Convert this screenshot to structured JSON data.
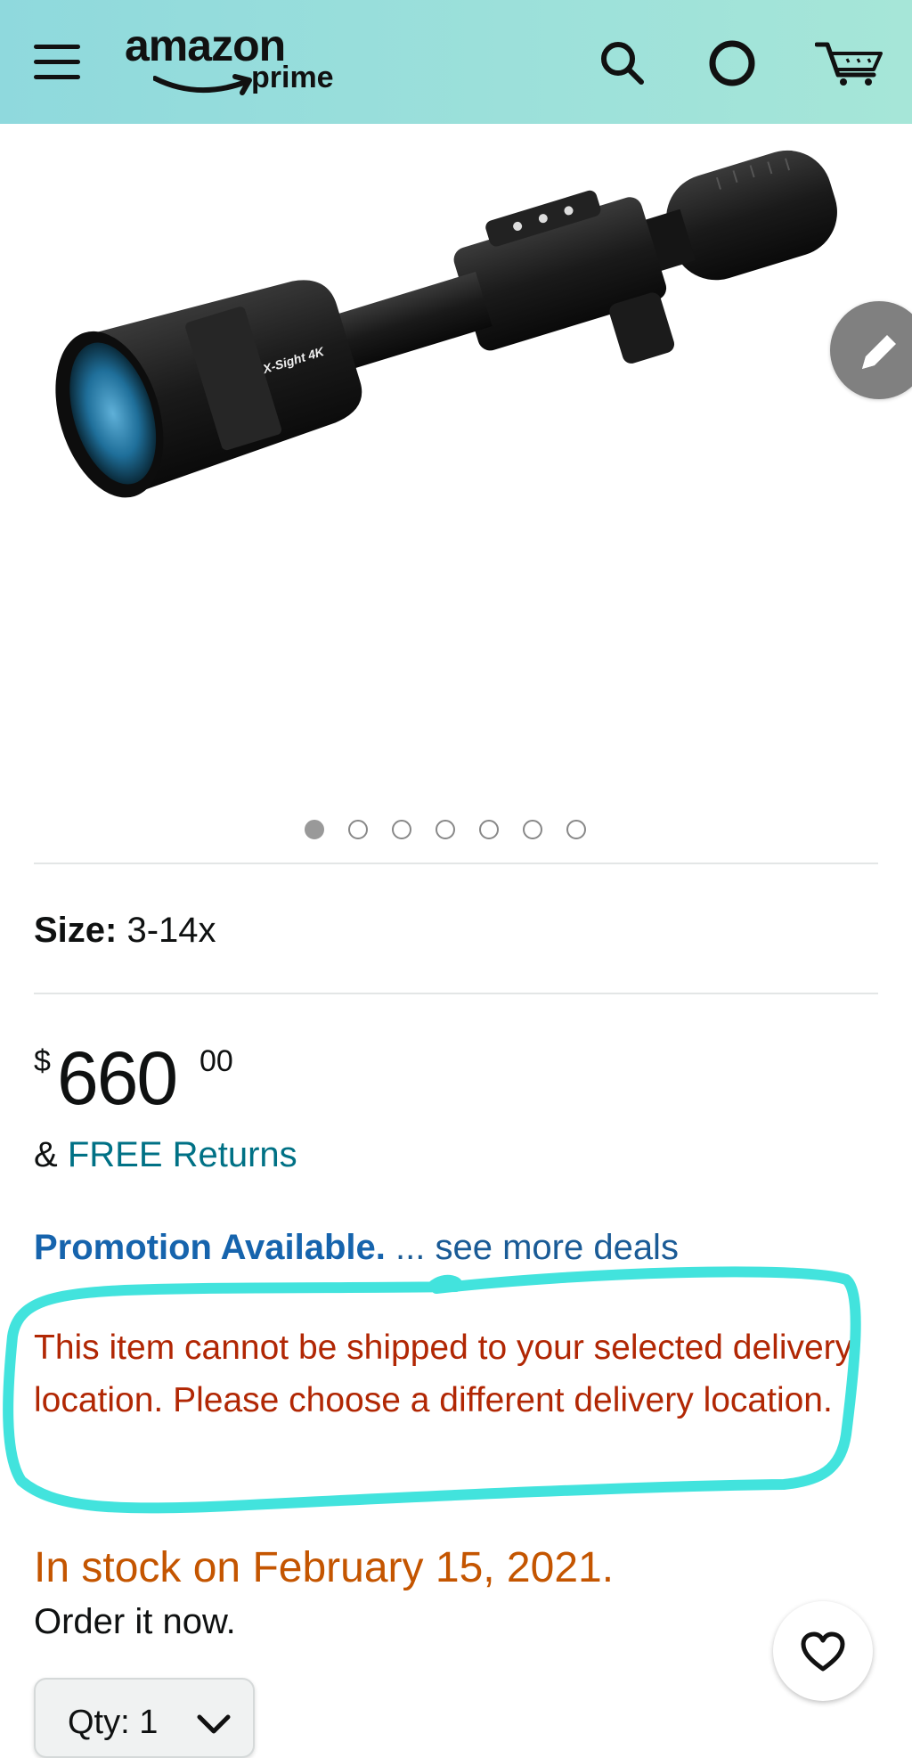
{
  "header": {
    "logo_word": "amazon",
    "logo_prime": "prime",
    "icons": [
      "menu-icon",
      "search-icon",
      "account-icon",
      "cart-icon"
    ],
    "colors": {
      "bar_start": "#8fd9dd",
      "bar_end": "#a6e6d8"
    }
  },
  "product": {
    "image_label": "X-Sight 4K",
    "image_count": 7,
    "active_image": 1
  },
  "size": {
    "label": "Size:",
    "value": "3-14x"
  },
  "price": {
    "currency": "$",
    "whole": "660",
    "fraction": "00"
  },
  "returns": {
    "prefix": "&",
    "link": "FREE Returns"
  },
  "promotion": {
    "label": "Promotion Available.",
    "more": "... see more deals"
  },
  "warning": "This item cannot be shipped to your selected delivery location. Please choose a different delivery location.",
  "stock": "In stock on February 15, 2021.",
  "order": "Order it now.",
  "quantity": {
    "label": "Qty:",
    "value": "1"
  },
  "colors": {
    "warning": "#b12704",
    "stock": "#c45500",
    "link": "#007185",
    "highlight": "#42e3dd"
  }
}
